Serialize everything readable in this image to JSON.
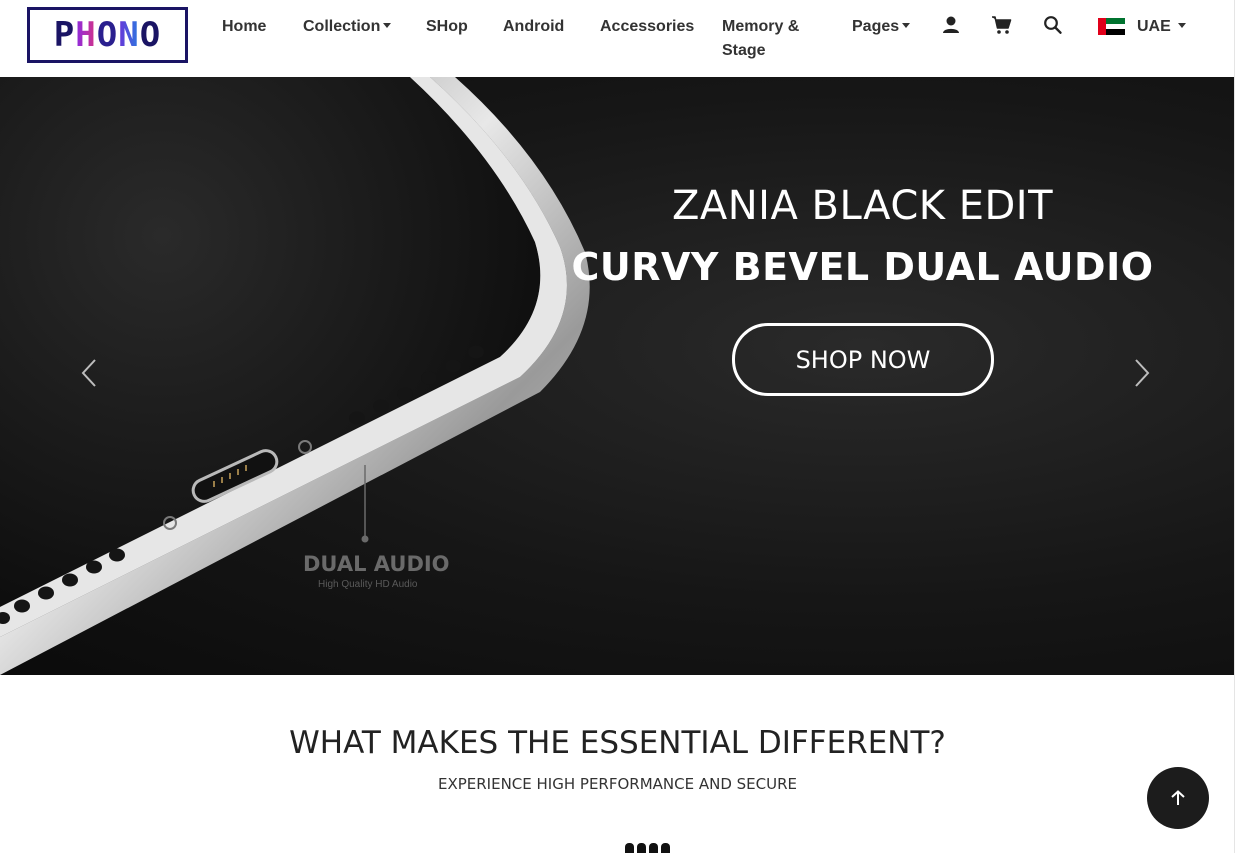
{
  "brand": {
    "logo_text": "PHONO"
  },
  "nav": {
    "items": [
      {
        "label": "Home",
        "dropdown": false
      },
      {
        "label": "Collection",
        "dropdown": true
      },
      {
        "label": "SHop",
        "dropdown": false
      },
      {
        "label": "Android",
        "dropdown": false
      },
      {
        "label": "Accessories",
        "dropdown": false
      },
      {
        "label": "Memory & Stage",
        "dropdown": false
      },
      {
        "label": "Pages",
        "dropdown": true
      }
    ],
    "icons": [
      "user-icon",
      "cart-icon",
      "search-icon"
    ],
    "country": {
      "label": "UAE",
      "flag": "uae-flag-icon",
      "flag_colors": [
        "#e1001a",
        "#00732f",
        "#ffffff",
        "#000000"
      ]
    }
  },
  "hero": {
    "title_line1": "ZANIA BLACK EDIT",
    "title_line2": "CURVY BEVEL DUAL AUDIO",
    "cta_label": "SHOP NOW",
    "image_label": "DUAL AUDIO",
    "image_sublabel": "High Quality HD Audio",
    "prev_icon": "chevron-left-icon",
    "next_icon": "chevron-right-icon"
  },
  "section": {
    "title": "WHAT MAKES THE ESSENTIAL DIFFERENT?",
    "subtitle": "EXPERIENCE HIGH PERFORMANCE AND SECURE"
  },
  "scroll_top": {
    "icon": "arrow-up-icon"
  },
  "colors": {
    "hero_bg": "#161616",
    "accent_logo": "#1a1464",
    "scroll_button": "#1c1c1c"
  }
}
